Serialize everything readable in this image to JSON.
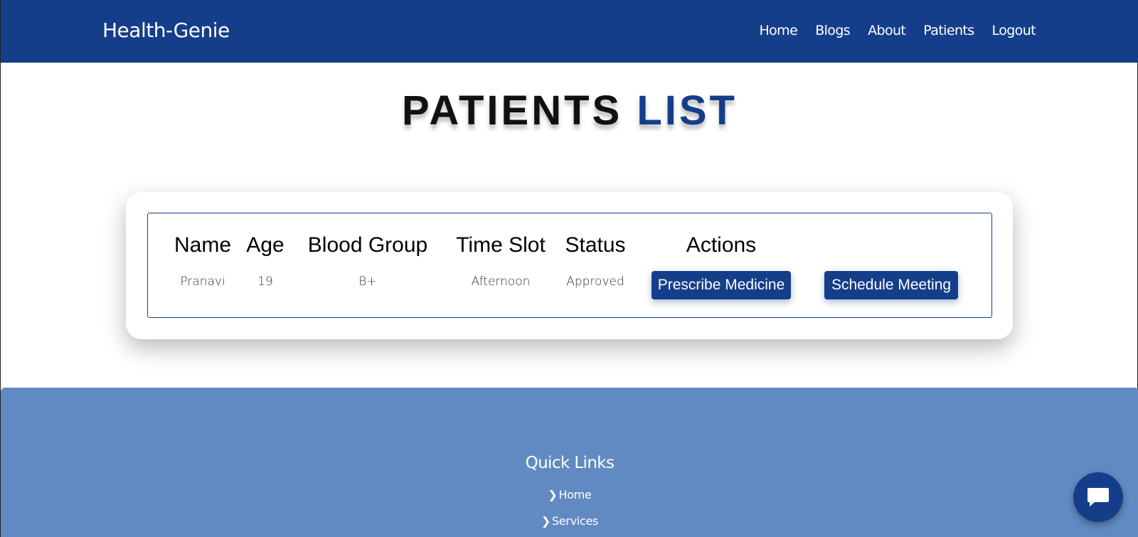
{
  "brand": "Health-Genie",
  "nav": [
    "Home",
    "Blogs",
    "About",
    "Patients",
    "Logout"
  ],
  "title": {
    "main": "PATIENTS",
    "accent": "LIST"
  },
  "table": {
    "headers": [
      "Name",
      "Age",
      "Blood Group",
      "Time Slot",
      "Status",
      "Actions"
    ],
    "rows": [
      {
        "name": "Pranavi",
        "age": "19",
        "blood_group": "B+",
        "time_slot": "Afternoon",
        "status": "Approved"
      }
    ],
    "actions": [
      "Prescribe Medicine",
      "Schedule Meeting"
    ]
  },
  "footer": {
    "title": "Quick Links",
    "links": [
      "Home",
      "Services"
    ]
  },
  "colors": {
    "primary": "#153e8a",
    "footer": "#628ac2"
  },
  "icons": {
    "chat": "chat-bubble-icon",
    "link": "chevron-right-icon"
  }
}
